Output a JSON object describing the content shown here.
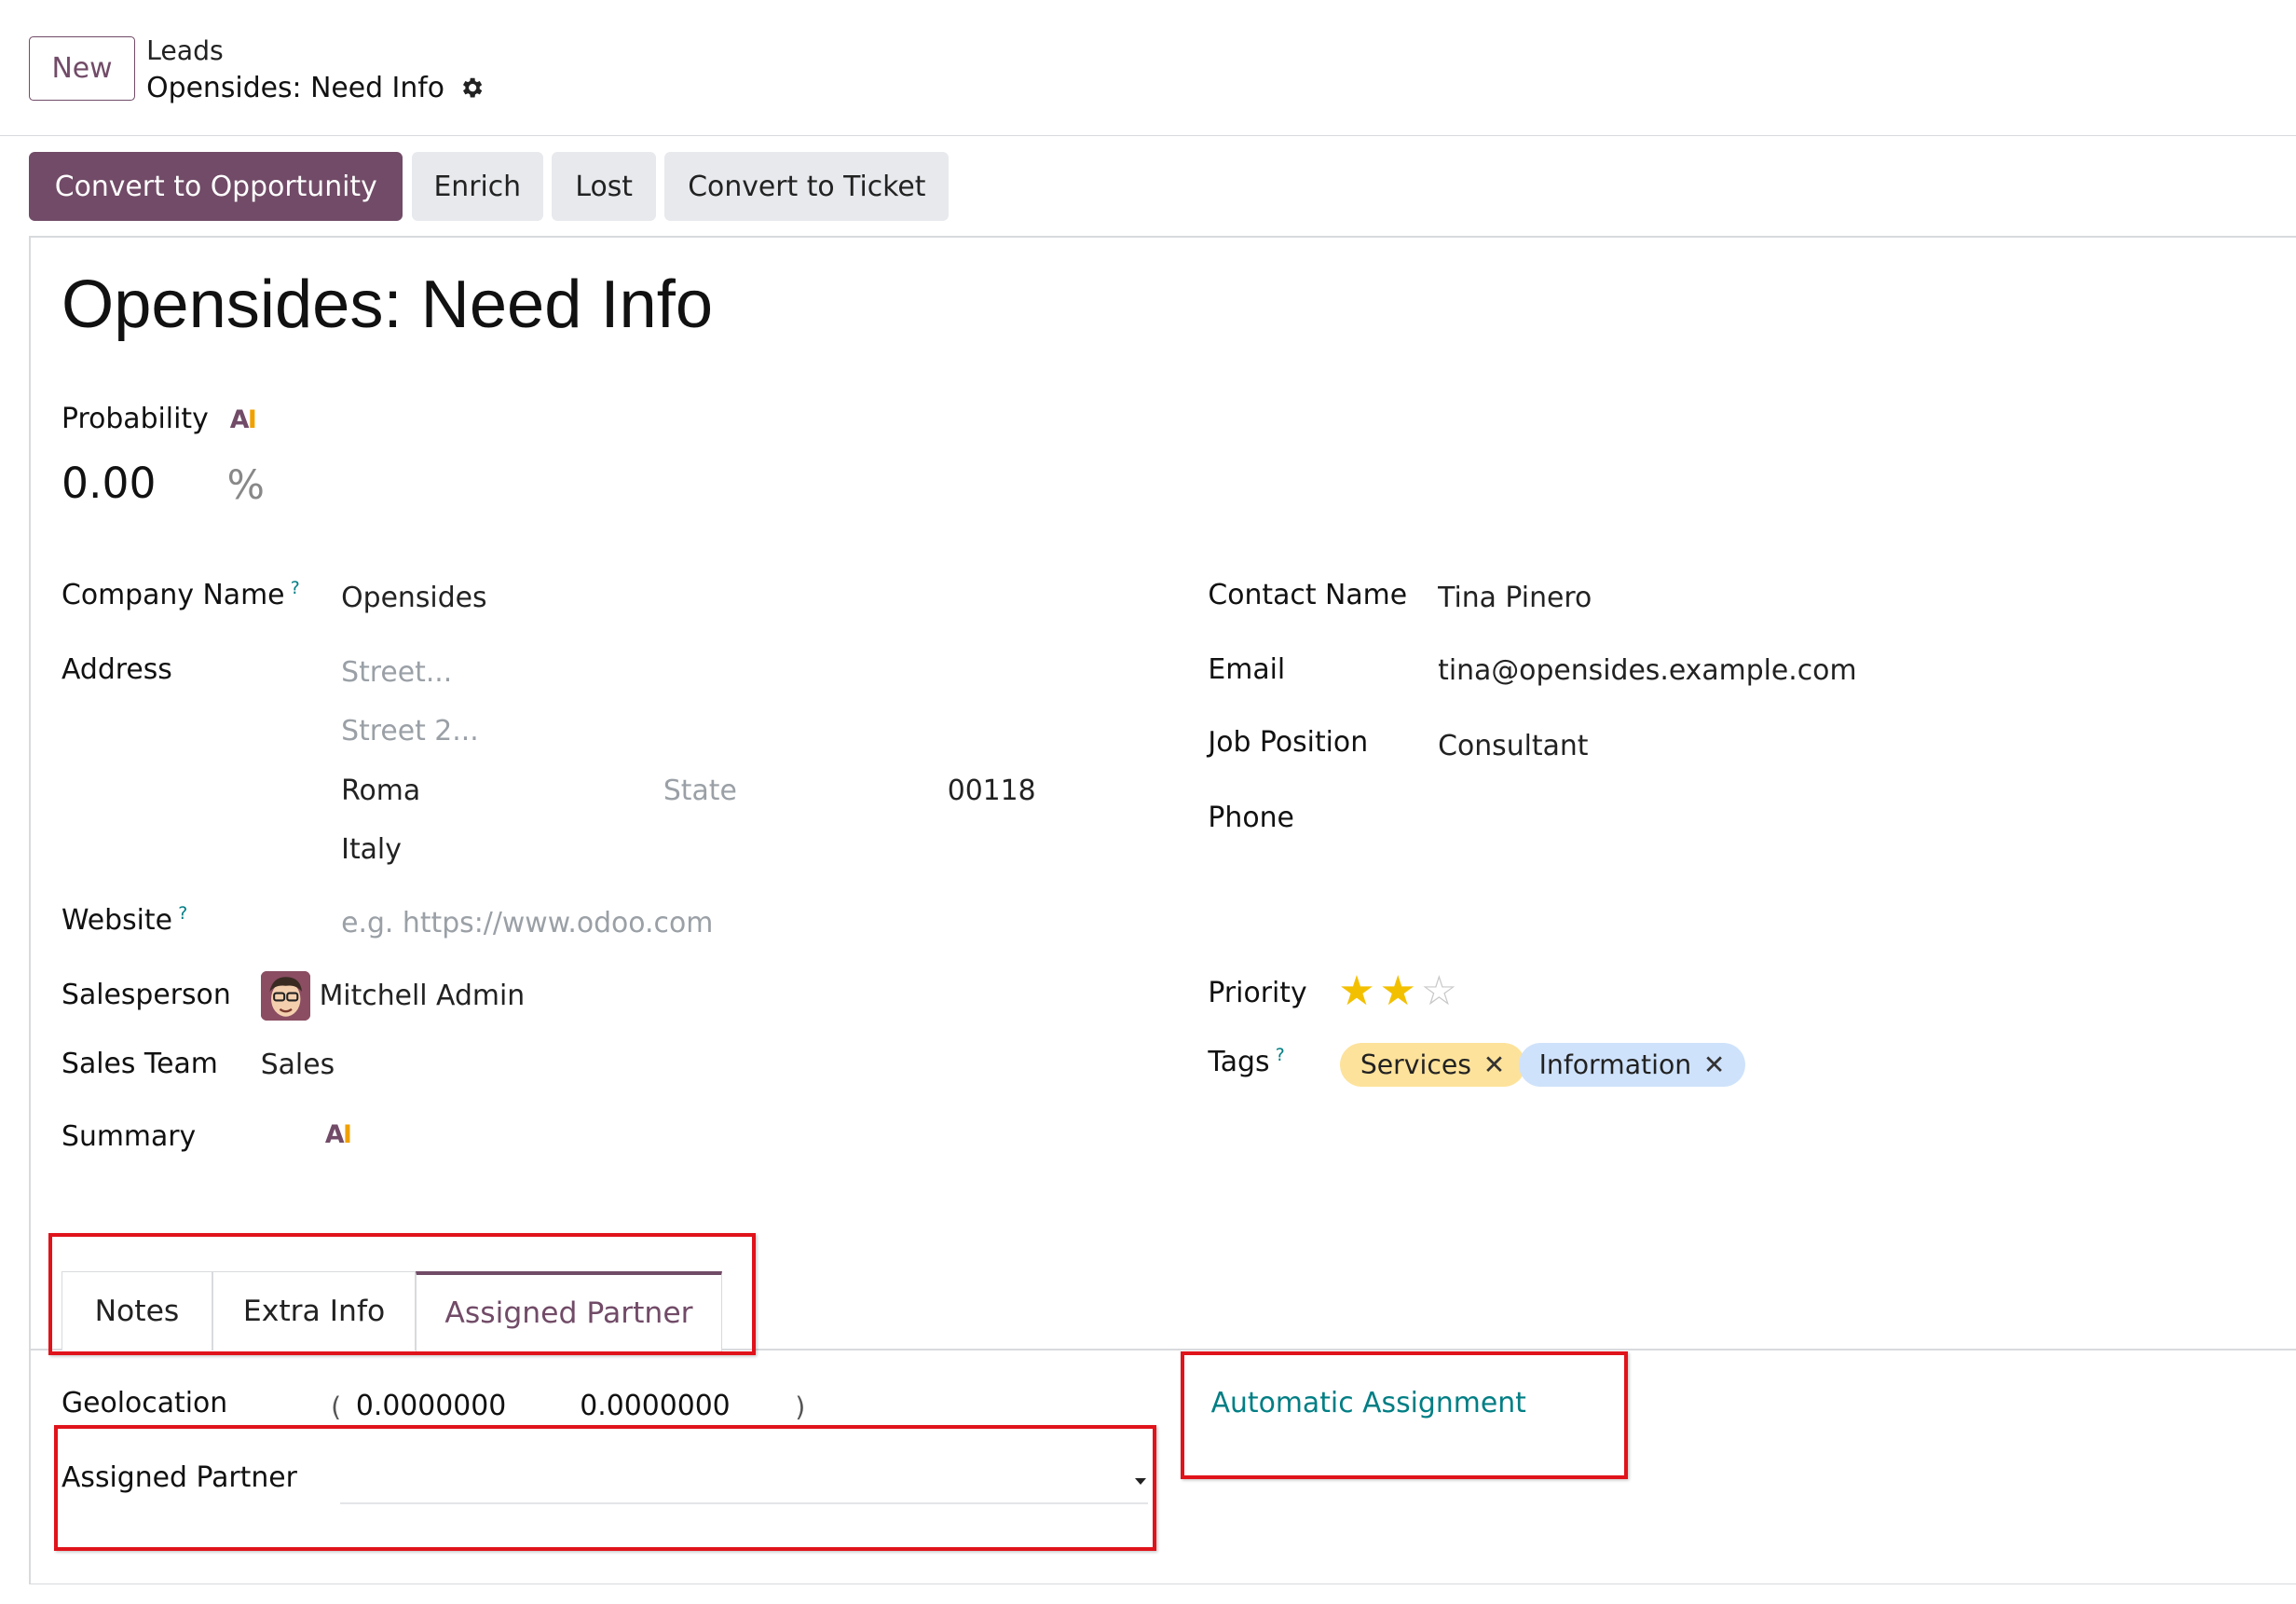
{
  "control_panel": {
    "new_label": "New",
    "breadcrumb_parent": "Leads",
    "breadcrumb_current": "Opensides: Need Info"
  },
  "actions": {
    "convert_opportunity": "Convert to Opportunity",
    "enrich": "Enrich",
    "lost": "Lost",
    "convert_ticket": "Convert to Ticket"
  },
  "record": {
    "title": "Opensides: Need Info",
    "probability_label": "Probability",
    "ai_badge_a": "A",
    "ai_badge_i": "I",
    "probability_value": "0.00",
    "probability_unit": "%"
  },
  "left_fields": {
    "company_label": "Company Name",
    "company_value": "Opensides",
    "address_label": "Address",
    "street_placeholder": "Street...",
    "street2_placeholder": "Street 2...",
    "city": "Roma",
    "state_placeholder": "State",
    "zip": "00118",
    "country": "Italy",
    "website_label": "Website",
    "website_placeholder": "e.g. https://www.odoo.com",
    "salesperson_label": "Salesperson",
    "salesperson_value": "Mitchell Admin",
    "sales_team_label": "Sales Team",
    "sales_team_value": "Sales",
    "summary_label": "Summary",
    "help_mark": "?"
  },
  "right_fields": {
    "contact_label": "Contact Name",
    "contact_value": "Tina Pinero",
    "email_label": "Email",
    "email_value": "tina@opensides.example.com",
    "job_label": "Job Position",
    "job_value": "Consultant",
    "phone_label": "Phone",
    "priority_label": "Priority",
    "priority_value": 2,
    "priority_max": 3,
    "tags_label": "Tags",
    "tags": [
      {
        "label": "Services",
        "remove": "✕",
        "color": "#fde29b"
      },
      {
        "label": "Information",
        "remove": "✕",
        "color": "#cfe2fb"
      }
    ]
  },
  "tabs": [
    {
      "label": "Notes"
    },
    {
      "label": "Extra Info"
    },
    {
      "label": "Assigned Partner"
    }
  ],
  "assigned_partner_tab": {
    "geolocation_label": "Geolocation",
    "paren_open": "(",
    "latitude": "0.0000000",
    "longitude": "0.0000000",
    "paren_close": ")",
    "assigned_partner_label": "Assigned Partner",
    "automatic_assignment_label": "Automatic Assignment"
  },
  "colors": {
    "brand": "#714B67",
    "link": "#017e84",
    "highlight_box": "#e0131b",
    "star_on": "#f3c000"
  }
}
